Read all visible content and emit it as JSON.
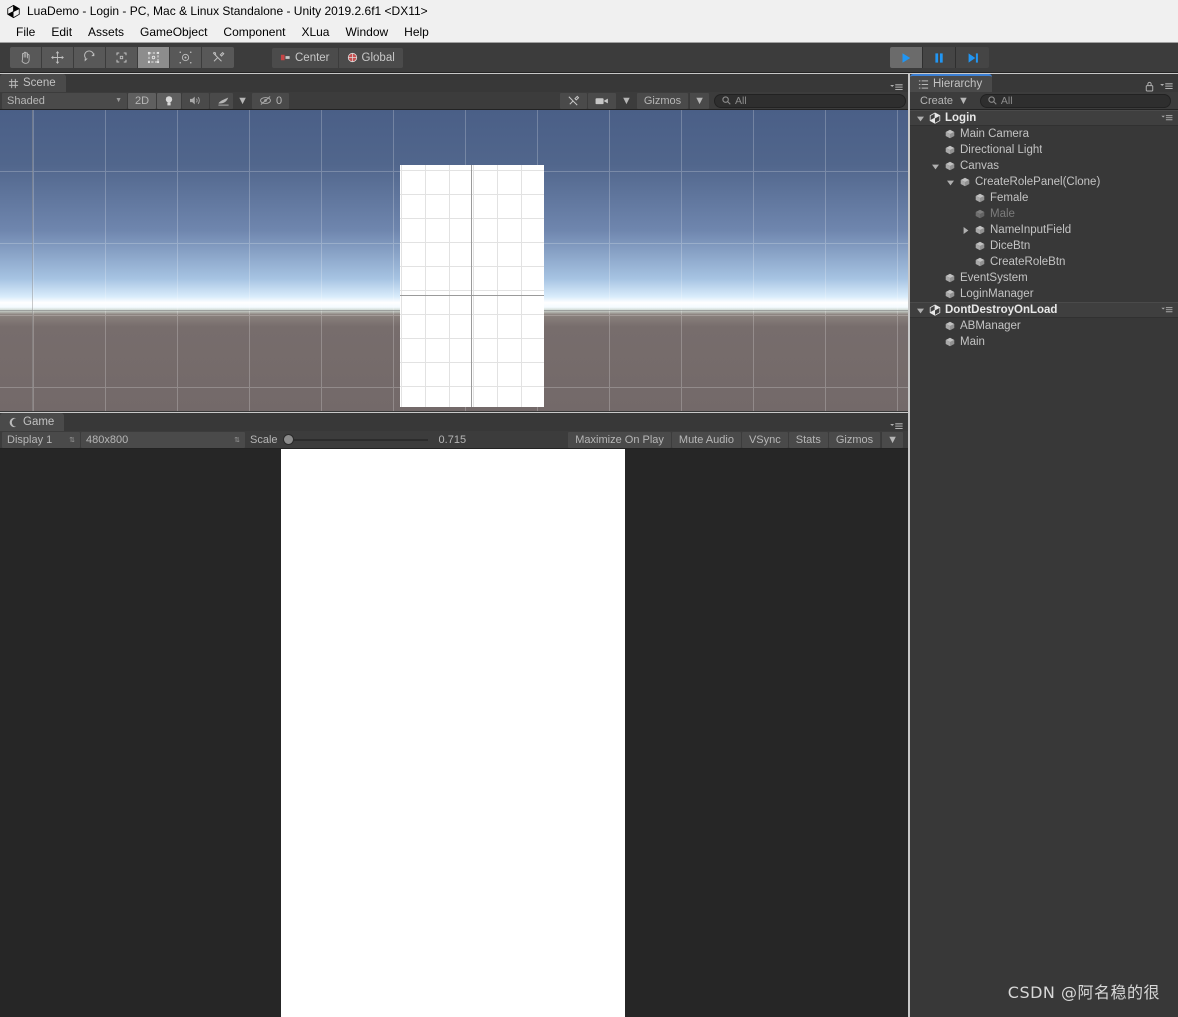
{
  "window": {
    "title": "LuaDemo - Login - PC, Mac & Linux Standalone - Unity 2019.2.6f1 <DX11>",
    "logo_icon": "unity-logo"
  },
  "menu": {
    "items": [
      {
        "label": "File"
      },
      {
        "label": "Edit"
      },
      {
        "label": "Assets"
      },
      {
        "label": "GameObject"
      },
      {
        "label": "Component"
      },
      {
        "label": "XLua"
      },
      {
        "label": "Window"
      },
      {
        "label": "Help"
      }
    ]
  },
  "toolbar": {
    "tools": [
      {
        "name": "hand-tool",
        "icon": "hand-icon",
        "active": false
      },
      {
        "name": "move-tool",
        "icon": "move-icon",
        "active": false
      },
      {
        "name": "rotate-tool",
        "icon": "rotate-icon",
        "active": false
      },
      {
        "name": "scale-tool",
        "icon": "scale-icon",
        "active": false
      },
      {
        "name": "rect-tool",
        "icon": "rect-icon",
        "active": true
      },
      {
        "name": "transform-tool",
        "icon": "transform-icon",
        "active": false
      },
      {
        "name": "custom-tool",
        "icon": "wrench-icon",
        "active": false
      }
    ],
    "pivot_label": "Center",
    "pivot_icon": "pivot-center-icon",
    "handle_label": "Global",
    "handle_icon": "globe-icon",
    "play_label": "play-button",
    "pause_label": "pause-button",
    "step_label": "step-button",
    "play_active": true,
    "accent_color": "#2196f3"
  },
  "scene_panel": {
    "tab_label": "Scene",
    "tab_icon": "scene-icon",
    "menu_icon": "panel-menu-icon",
    "draw_mode": "Shaded",
    "toggle_2d": "2D",
    "lighting_icon": "lightbulb-icon",
    "audio_icon": "speaker-icon",
    "effects_icon": "effects-icon",
    "hidden_count": "0",
    "hidden_icon": "eye-slash-icon",
    "tools_icon": "scene-tools-icon",
    "camera_icon": "camera-icon",
    "gizmos_label": "Gizmos",
    "search_placeholder": "All",
    "search_icon": "search-icon",
    "sky_top_color": "#4a5f87",
    "ground_color": "#736969"
  },
  "game_panel": {
    "tab_label": "Game",
    "tab_icon": "game-icon",
    "menu_icon": "panel-menu-icon",
    "display": "Display 1",
    "resolution": "480x800",
    "scale_label": "Scale",
    "scale_value": "0.715",
    "maximize_label": "Maximize On Play",
    "mute_label": "Mute Audio",
    "vsync_label": "VSync",
    "stats_label": "Stats",
    "gizmos_label": "Gizmos",
    "background_color": "#262626",
    "render_color": "#ffffff"
  },
  "hierarchy": {
    "tab_label": "Hierarchy",
    "tab_icon": "hierarchy-icon",
    "lock_icon": "lock-icon",
    "menu_icon": "panel-menu-icon",
    "create_label": "Create",
    "search_placeholder": "All",
    "search_icon": "search-icon",
    "focused": true,
    "rows": [
      {
        "label": "Login",
        "depth": 0,
        "type": "scene",
        "twisty": "open",
        "icon": "unity-scene-icon",
        "dim": false,
        "menu": true
      },
      {
        "label": "Main Camera",
        "depth": 1,
        "type": "object",
        "twisty": "none",
        "icon": "gameobject-icon",
        "dim": false,
        "menu": false
      },
      {
        "label": "Directional Light",
        "depth": 1,
        "type": "object",
        "twisty": "none",
        "icon": "gameobject-icon",
        "dim": false,
        "menu": false
      },
      {
        "label": "Canvas",
        "depth": 1,
        "type": "object",
        "twisty": "open",
        "icon": "gameobject-icon",
        "dim": false,
        "menu": false
      },
      {
        "label": "CreateRolePanel(Clone)",
        "depth": 2,
        "type": "object",
        "twisty": "open",
        "icon": "gameobject-icon",
        "dim": false,
        "menu": false
      },
      {
        "label": "Female",
        "depth": 3,
        "type": "object",
        "twisty": "none",
        "icon": "gameobject-icon",
        "dim": false,
        "menu": false
      },
      {
        "label": "Male",
        "depth": 3,
        "type": "object",
        "twisty": "none",
        "icon": "gameobject-icon",
        "dim": true,
        "menu": false
      },
      {
        "label": "NameInputField",
        "depth": 3,
        "type": "object",
        "twisty": "closed",
        "icon": "gameobject-icon",
        "dim": false,
        "menu": false
      },
      {
        "label": "DiceBtn",
        "depth": 3,
        "type": "object",
        "twisty": "none",
        "icon": "gameobject-icon",
        "dim": false,
        "menu": false
      },
      {
        "label": "CreateRoleBtn",
        "depth": 3,
        "type": "object",
        "twisty": "none",
        "icon": "gameobject-icon",
        "dim": false,
        "menu": false
      },
      {
        "label": "EventSystem",
        "depth": 1,
        "type": "object",
        "twisty": "none",
        "icon": "gameobject-icon",
        "dim": false,
        "menu": false
      },
      {
        "label": "LoginManager",
        "depth": 1,
        "type": "object",
        "twisty": "none",
        "icon": "gameobject-icon",
        "dim": false,
        "menu": false
      },
      {
        "label": "DontDestroyOnLoad",
        "depth": 0,
        "type": "scene",
        "twisty": "open",
        "icon": "unity-scene-icon",
        "dim": false,
        "menu": true
      },
      {
        "label": "ABManager",
        "depth": 1,
        "type": "object",
        "twisty": "none",
        "icon": "gameobject-icon",
        "dim": false,
        "menu": false
      },
      {
        "label": "Main",
        "depth": 1,
        "type": "object",
        "twisty": "none",
        "icon": "gameobject-icon",
        "dim": false,
        "menu": false
      }
    ]
  },
  "watermark": {
    "text": "CSDN @阿名稳的很"
  }
}
